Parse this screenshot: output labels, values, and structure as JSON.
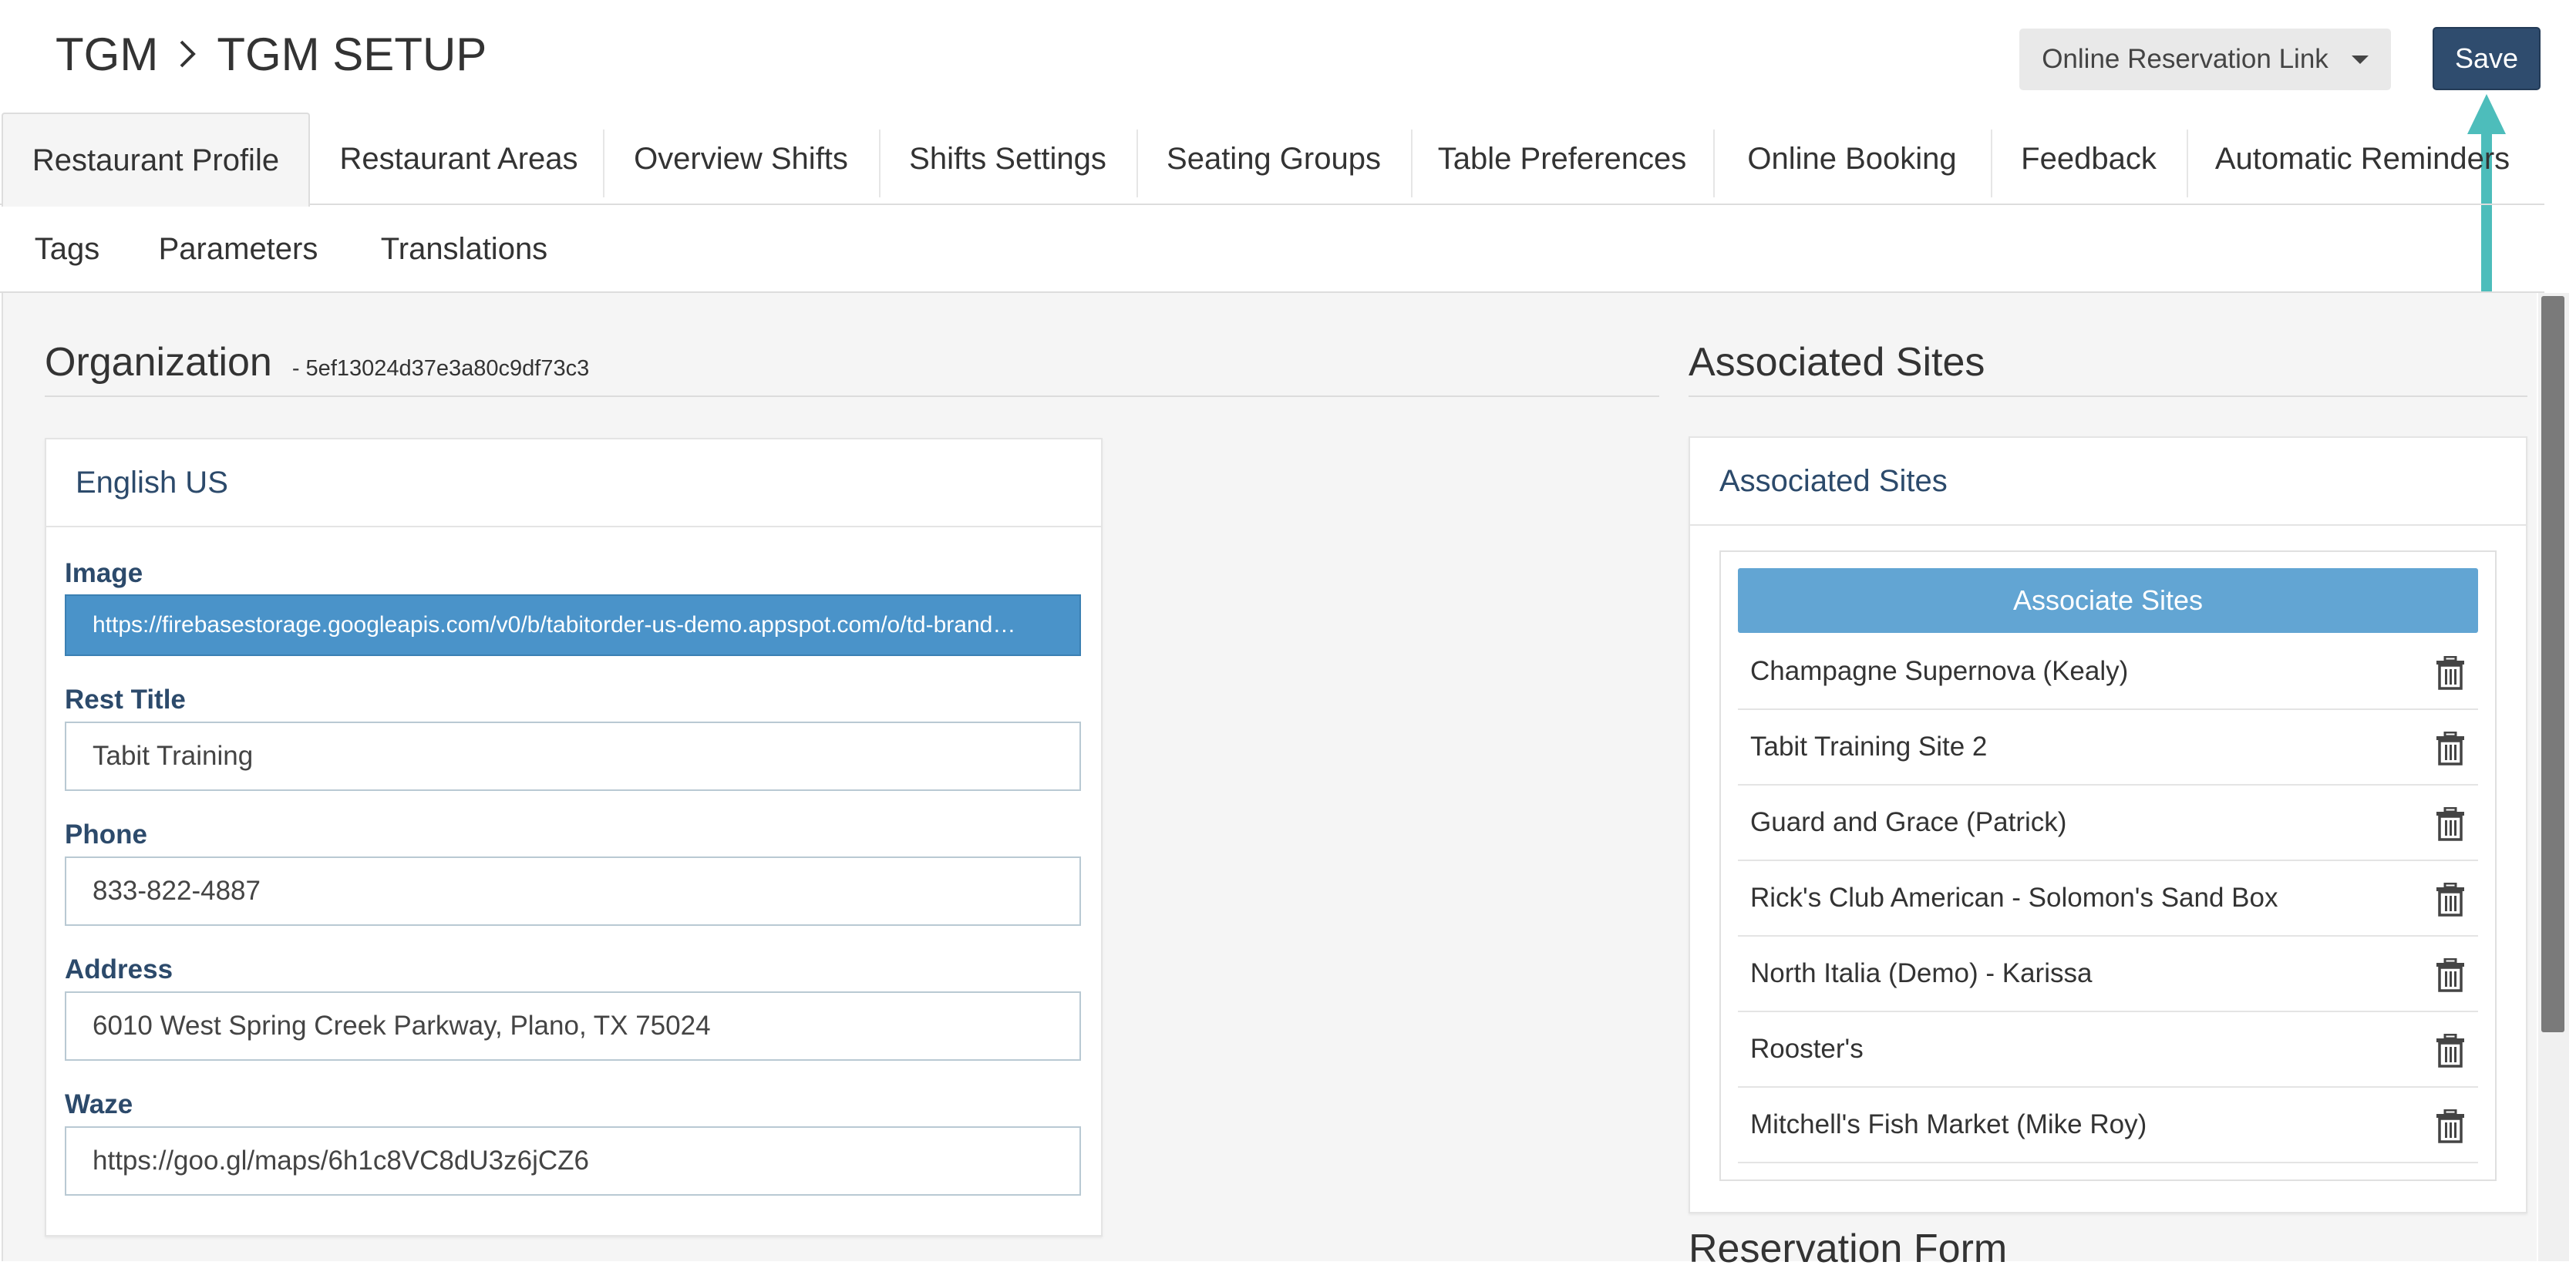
{
  "breadcrumb": {
    "root": "TGM",
    "current": "TGM SETUP"
  },
  "header": {
    "reservation_link_label": "Online Reservation Link",
    "save_label": "Save"
  },
  "tabs": [
    "Restaurant Profile",
    "Restaurant Areas",
    "Overview Shifts",
    "Shifts Settings",
    "Seating Groups",
    "Table Preferences",
    "Online Booking",
    "Feedback",
    "Automatic Reminders"
  ],
  "tabs2": [
    "Tags",
    "Parameters",
    "Translations"
  ],
  "active_tab": "Restaurant Profile",
  "organization": {
    "title": "Organization",
    "id": "- 5ef13024d37e3a80c9df73c3"
  },
  "profile_card": {
    "title": "English US",
    "fields": {
      "image": {
        "label": "Image",
        "value": "https://firebasestorage.googleapis.com/v0/b/tabitorder-us-demo.appspot.com/o/td-brand…"
      },
      "rest_title": {
        "label": "Rest Title",
        "value": "Tabit Training"
      },
      "phone": {
        "label": "Phone",
        "value": "833-822-4887"
      },
      "address": {
        "label": "Address",
        "value": "6010 West Spring Creek Parkway, Plano, TX 75024"
      },
      "waze": {
        "label": "Waze",
        "value": "https://goo.gl/maps/6h1c8VC8dU3z6jCZ6"
      }
    }
  },
  "associated_sites": {
    "section_title": "Associated Sites",
    "card_title": "Associated Sites",
    "button_label": "Associate Sites",
    "sites": [
      "Champagne Supernova (Kealy)",
      "Tabit Training Site 2",
      "Guard and Grace (Patrick)",
      "Rick's Club American - Solomon's Sand Box",
      "North Italia (Demo) - Karissa",
      "Rooster's",
      "Mitchell's Fish Market (Mike Roy)"
    ]
  },
  "reservation_form": {
    "title": "Reservation Form"
  },
  "colors": {
    "primary": "#2f4c6e",
    "selected_input": "#4a93c9",
    "associate_button": "#62a5d3",
    "callout_arrow": "#4dbdbb",
    "heading_blue": "#2c4a6b"
  },
  "icons": [
    "chevron-right-icon",
    "caret-down-icon",
    "trash-icon",
    "callout-arrow-icon"
  ]
}
